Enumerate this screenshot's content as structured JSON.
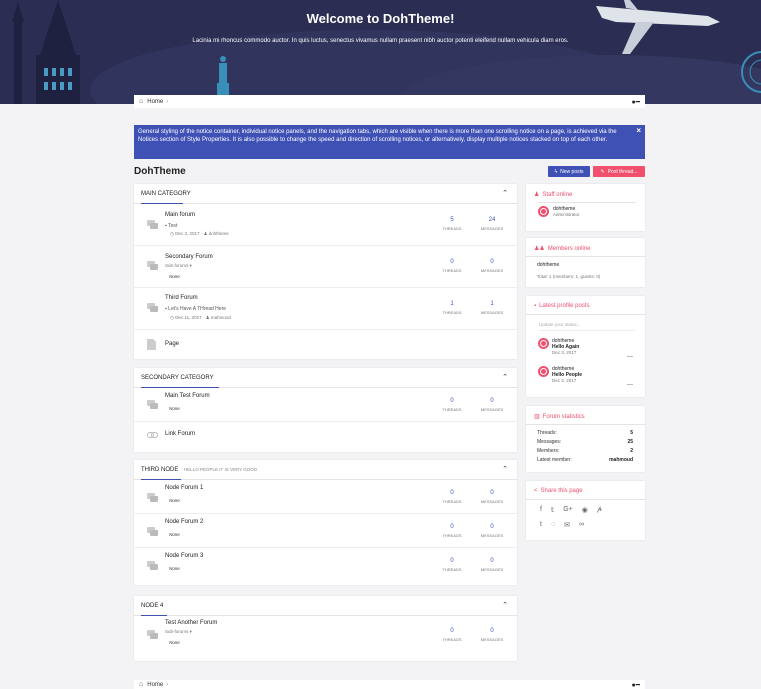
{
  "hero": {
    "title": "Welcome to DohTheme!",
    "subtitle": "Lacinia mi rhoncus commodo auctor. In quis luctus, senectus vivamus nullam praesent nibh auctor potenti eleifend nullam vehicula diam eros."
  },
  "breadcrumb": {
    "home": "Home"
  },
  "notice": {
    "text": "General styling of the notice container, individual notice panels, and the navigation tabs, which are visible when there is more than one scrolling notice on a page, is achieved via the Notices section of Style Properties. It is also possible to change the speed and direction of scrolling notices, or alternatively, display multiple notices stacked on top of each other.",
    "close": "×"
  },
  "page": {
    "title": "DohTheme",
    "new_posts": "New posts",
    "post_thread": "Post thread..."
  },
  "labels": {
    "threads": "THREADS",
    "messages": "MESSAGES",
    "none": "None",
    "sub_forums": "Sub-forums"
  },
  "categories": [
    {
      "title": "MAIN CATEGORY",
      "nodes": [
        {
          "title": "Main forum",
          "last_thread": "Test",
          "date": "Dec 3, 2017",
          "user": "dohtheme",
          "threads": "5",
          "messages": "24"
        },
        {
          "title": "Secondary Forum",
          "threads": "0",
          "messages": "0"
        },
        {
          "title": "Third Forum",
          "last_thread": "Let's Have A THread Here",
          "date": "Dec 11, 2017",
          "user": "mahmoud",
          "threads": "1",
          "messages": "1"
        },
        {
          "title": "Page"
        }
      ]
    },
    {
      "title": "SECONDARY CATEGORY",
      "nodes": [
        {
          "title": "Main Test Forum",
          "threads": "0",
          "messages": "0"
        },
        {
          "title": "Link Forum"
        }
      ]
    },
    {
      "title": "THIRD NODE",
      "description": "HELLO PEOPLE IT IS VERY GOOD",
      "nodes": [
        {
          "title": "Node Forum 1",
          "threads": "0",
          "messages": "0"
        },
        {
          "title": "Node Forum 2",
          "threads": "0",
          "messages": "0"
        },
        {
          "title": "Node Forum 3",
          "threads": "0",
          "messages": "0"
        }
      ]
    },
    {
      "title": "NODE 4",
      "nodes": [
        {
          "title": "Test Another Forum",
          "threads": "0",
          "messages": "0"
        }
      ]
    }
  ],
  "sidebar": {
    "staff": {
      "title": "Staff online",
      "user": "dohtheme",
      "role": "Administrator"
    },
    "members": {
      "title": "Members online",
      "user": "dohtheme",
      "total": "Total: 1 (members: 1, guests: 0)"
    },
    "profile_posts": {
      "title": "Latest profile posts",
      "placeholder": "Update your status...",
      "posts": [
        {
          "user": "dohtheme",
          "text": "Hello Again",
          "date": "Dec 3, 2017"
        },
        {
          "user": "dohtheme",
          "text": "Hello People",
          "date": "Dec 3, 2017"
        }
      ]
    },
    "stats": {
      "title": "Forum statistics",
      "rows": [
        {
          "label": "Threads:",
          "value": "5"
        },
        {
          "label": "Messages:",
          "value": "25"
        },
        {
          "label": "Members:",
          "value": "2"
        },
        {
          "label": "Latest member:",
          "value": "mahmoud"
        }
      ]
    },
    "share": {
      "title": "Share this page",
      "icons": [
        "facebook-icon",
        "twitter-icon",
        "google-plus-icon",
        "reddit-icon",
        "pinterest-icon",
        "tumblr-icon",
        "whatsapp-icon",
        "email-icon",
        "link-icon"
      ]
    }
  },
  "colors": {
    "accent": "#3f51b5",
    "pink": "#f0506e",
    "hero": "#2b2d53"
  }
}
